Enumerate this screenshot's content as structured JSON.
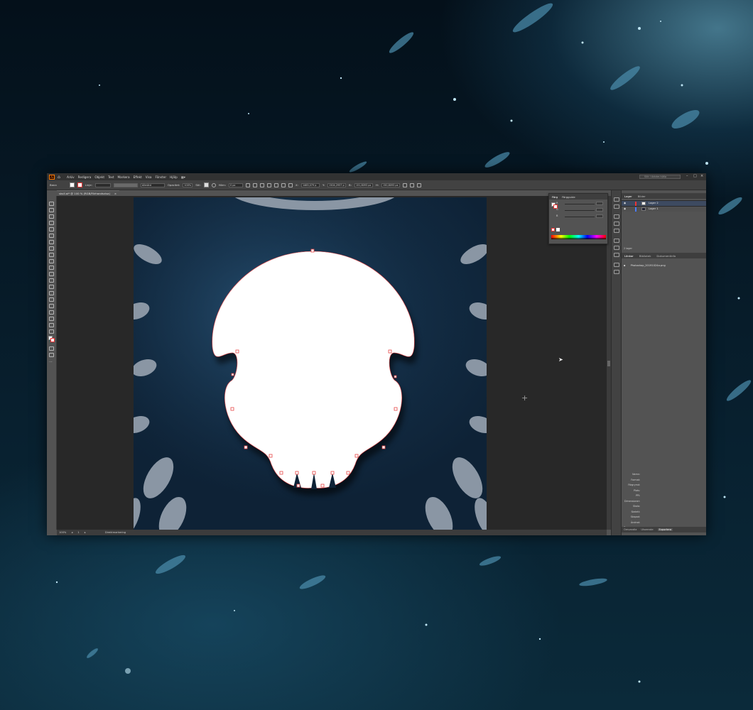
{
  "app": {
    "logo": "Ai",
    "menu": [
      "Arkiv",
      "Redigera",
      "Objekt",
      "Text",
      "Markera",
      "Effekt",
      "Visa",
      "Fönster",
      "Hjälp"
    ],
    "search_placeholder": "Sök i Adobe-hjälp"
  },
  "control_bar": {
    "selection_label": "Bana",
    "stroke_label": "Linje:",
    "profile_label": "Allmänt",
    "opacity_label": "Opacitet:",
    "opacity_value": "100%",
    "style_label": "Stil:",
    "align_label": "Hörn:",
    "corner_value": "0 px",
    "x_label": "X:",
    "x_value": "1463,079 p",
    "y_label": "Y:",
    "y_value": "1504,2957 p",
    "w_label": "B:",
    "w_value": "151,8093 px",
    "h_label": "H:",
    "h_value": "150,8093 px"
  },
  "document": {
    "tab_title": "skull.ai* @ 100 % (RGB/Förhandsvisa)",
    "zoom": "100%",
    "artboard_num": "1",
    "status_text": "Direktmarkering"
  },
  "color_panel": {
    "tabs": [
      "Färg",
      "Färgguide"
    ],
    "channels": [
      "R",
      "G",
      "B"
    ]
  },
  "layers_panel": {
    "tabs": [
      "Lager",
      "Bilder"
    ],
    "layers": [
      {
        "name": "Lager 2"
      },
      {
        "name": "Lager 1"
      }
    ],
    "count": "2 lager"
  },
  "links_panel": {
    "tabs": [
      "Länkar",
      "Bibliotek",
      "Dokumentinfo"
    ],
    "file": "Photoshop_20191024a.png",
    "properties": [
      "Namn:",
      "Format:",
      "Färgrymd:",
      "Plats:",
      "PPI:",
      "Dimensioner:",
      "Skala:",
      "Skelett:",
      "Skapad:",
      "Ändrad:",
      "Transparency:"
    ]
  },
  "bottom_tabs": [
    "Omvandla",
    "Utseende",
    "Exportera"
  ],
  "colors": {
    "accent_red": "#e64646",
    "panel_bg": "#535353",
    "canvas_bg": "#282828",
    "artboard_bg": "#132d45"
  }
}
